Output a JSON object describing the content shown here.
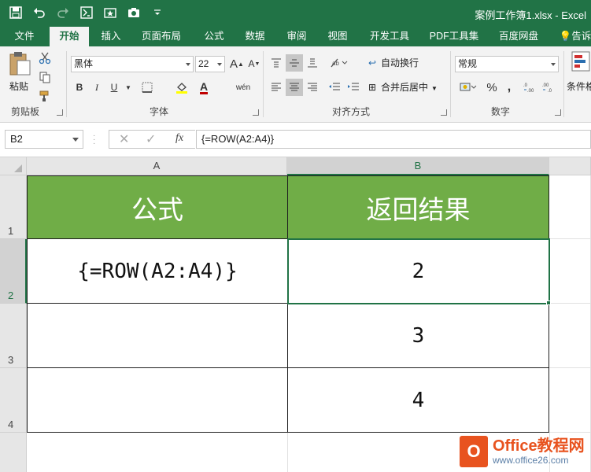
{
  "window": {
    "title": "案例工作簿1.xlsx - Excel"
  },
  "quick_access": [
    {
      "icon": "save-icon"
    },
    {
      "icon": "undo-icon"
    },
    {
      "icon": "redo-icon"
    },
    {
      "icon": "formula-icon"
    },
    {
      "icon": "star-doc-icon"
    },
    {
      "icon": "camera-icon"
    },
    {
      "icon": "customize-icon"
    }
  ],
  "tabs": [
    "文件",
    "开始",
    "插入",
    "页面布局",
    "公式",
    "数据",
    "审阅",
    "视图",
    "开发工具",
    "PDF工具集",
    "百度网盘",
    "告诉"
  ],
  "active_tab": "开始",
  "ribbon": {
    "clipboard": {
      "label": "剪贴板",
      "paste": "粘贴"
    },
    "font": {
      "label": "字体",
      "font_name": "黑体",
      "font_size": "22",
      "bold": "B",
      "italic": "I",
      "underline": "U",
      "grow": "A",
      "shrink": "A",
      "phonetic": "wén"
    },
    "alignment": {
      "label": "对齐方式",
      "wrap": "自动换行",
      "merge": "合并后居中"
    },
    "number": {
      "label": "数字",
      "format": "常规",
      "percent": "%",
      "comma": ","
    },
    "styles": {
      "cond_format": "条件格"
    }
  },
  "formula_bar": {
    "name_box": "B2",
    "formula": "{=ROW(A2:A4)}",
    "fx": "fx"
  },
  "sheet": {
    "columns": [
      "A",
      "B"
    ],
    "rows": [
      "1",
      "2",
      "3",
      "4"
    ],
    "selected": "B2",
    "header": [
      "公式",
      "返回结果"
    ],
    "cells": [
      [
        "{=ROW(A2:A4)}",
        "2"
      ],
      [
        "",
        "3"
      ],
      [
        "",
        "4"
      ]
    ]
  },
  "watermark": {
    "name": "Office教程网",
    "url": "www.office26.com",
    "logo": "O"
  },
  "colors": {
    "excel_green": "#217346",
    "header_fill": "#70ad47",
    "watermark_orange": "#e8531f"
  }
}
